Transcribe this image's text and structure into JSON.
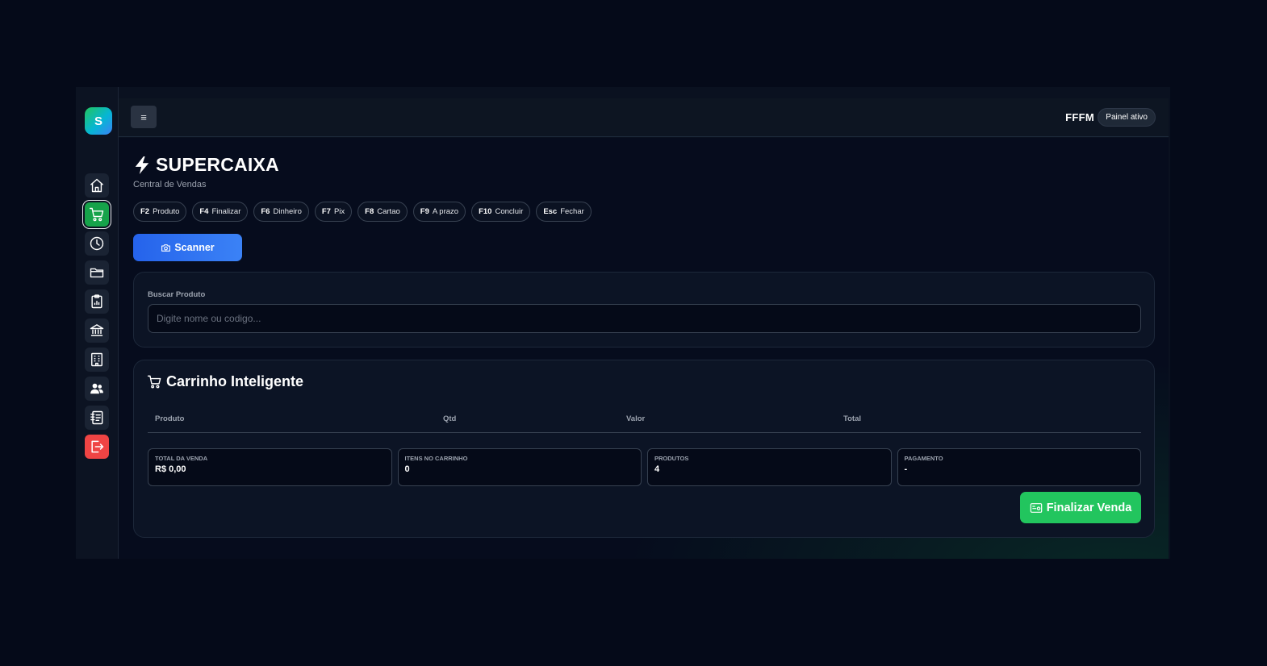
{
  "sidebar": {
    "logo": "S",
    "items": [
      {
        "icon": "home-icon"
      },
      {
        "icon": "cart-icon",
        "active": true
      },
      {
        "icon": "clock-icon"
      },
      {
        "icon": "folder-icon"
      },
      {
        "icon": "clipboard-chart-icon"
      },
      {
        "icon": "bank-icon"
      },
      {
        "icon": "building-icon"
      },
      {
        "icon": "users-icon"
      },
      {
        "icon": "journal-icon"
      },
      {
        "icon": "logout-icon"
      }
    ]
  },
  "topbar": {
    "menu_icon": "≡",
    "user": "FFFM",
    "status": "Painel ativo"
  },
  "header": {
    "title": "SUPERCAIXA",
    "subtitle": "Central de Vendas"
  },
  "shortcuts": [
    {
      "key": "F2",
      "label": "Produto"
    },
    {
      "key": "F4",
      "label": "Finalizar"
    },
    {
      "key": "F6",
      "label": "Dinheiro"
    },
    {
      "key": "F7",
      "label": "Pix"
    },
    {
      "key": "F8",
      "label": "Cartao"
    },
    {
      "key": "F9",
      "label": "A prazo"
    },
    {
      "key": "F10",
      "label": "Concluir"
    },
    {
      "key": "Esc",
      "label": "Fechar"
    }
  ],
  "scanner": {
    "label": "Scanner"
  },
  "search": {
    "label": "Buscar Produto",
    "value": "",
    "placeholder": "Digite nome ou codigo..."
  },
  "cart": {
    "title": "Carrinho Inteligente",
    "columns": [
      "Produto",
      "Qtd",
      "Valor",
      "Total"
    ],
    "rows": []
  },
  "stats": {
    "total": {
      "label": "TOTAL DA VENDA",
      "value": "R$ 0,00"
    },
    "items": {
      "label": "ITENS NO CARRINHO",
      "value": "0"
    },
    "products": {
      "label": "PRODUTOS",
      "value": "4"
    },
    "payment": {
      "label": "PAGAMENTO",
      "value": "-"
    }
  },
  "finalize": {
    "label": "Finalizar Venda"
  },
  "colors": {
    "accent_green": "#22c55e",
    "accent_blue": "#3b82f6",
    "danger": "#ef4444",
    "background": "#050a19"
  }
}
